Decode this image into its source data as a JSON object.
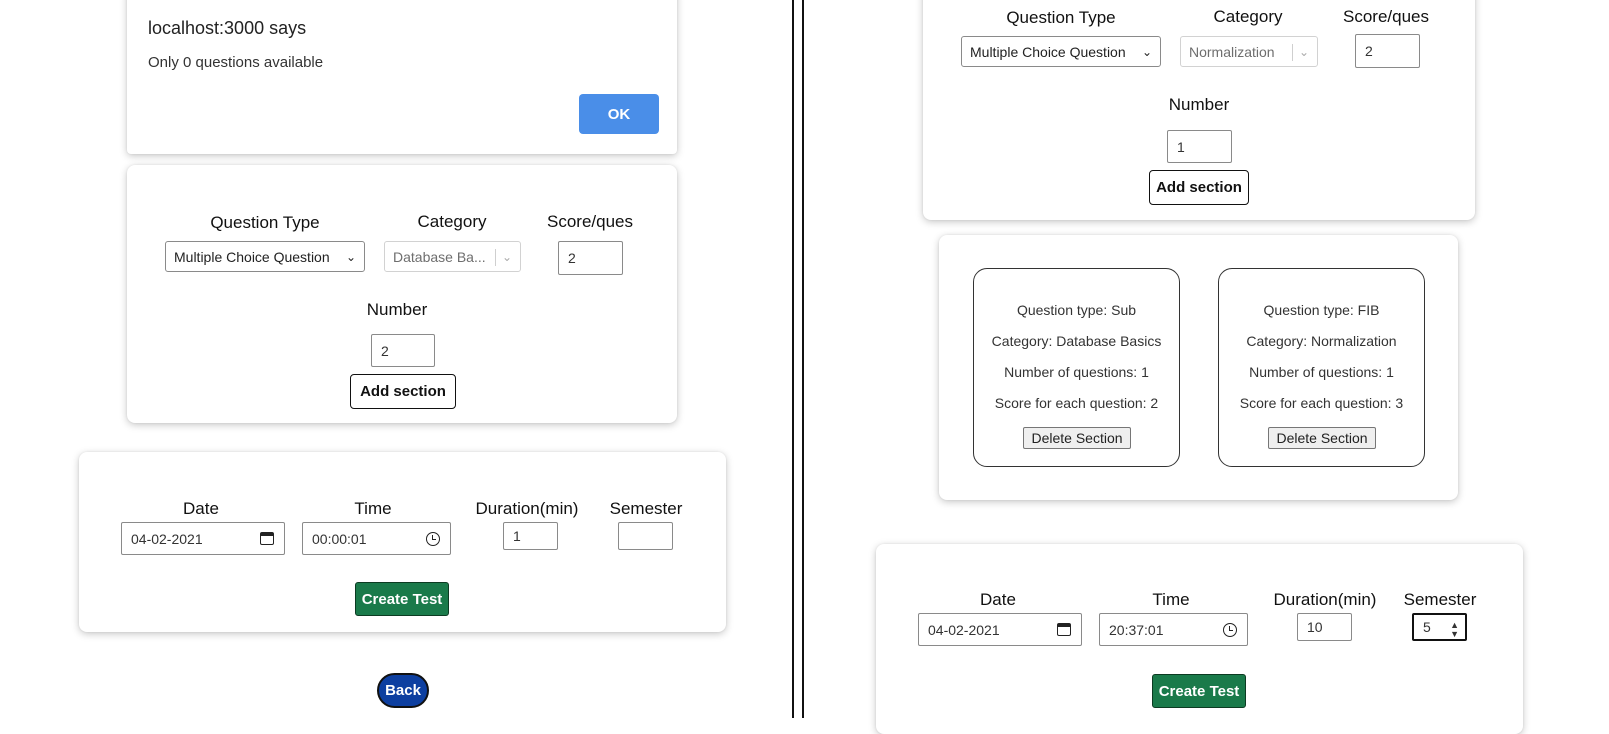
{
  "dialog": {
    "title": "localhost:3000 says",
    "message": "Only 0 questions available",
    "ok_label": "OK"
  },
  "left": {
    "section_form": {
      "question_type_label": "Question Type",
      "question_type_value": "Multiple Choice Question",
      "category_label": "Category",
      "category_value": "Database Ba...",
      "score_label": "Score/ques",
      "score_value": "2",
      "number_label": "Number",
      "number_value": "2",
      "add_section_label": "Add section"
    },
    "test_form": {
      "date_label": "Date",
      "date_value": "04-02-2021",
      "time_label": "Time",
      "time_value": "00:00:01",
      "duration_label": "Duration(min)",
      "duration_value": "1",
      "semester_label": "Semester",
      "semester_value": "",
      "create_label": "Create Test"
    },
    "back_label": "Back"
  },
  "right": {
    "section_form": {
      "question_type_label": "Question Type",
      "question_type_value": "Multiple Choice Question",
      "category_label": "Category",
      "category_value": "Normalization",
      "score_label": "Score/ques",
      "score_value": "2",
      "number_label": "Number",
      "number_value": "1",
      "add_section_label": "Add section"
    },
    "sections": [
      {
        "type": "Question type: Sub",
        "category": "Category: Database Basics",
        "count": "Number of questions: 1",
        "score": "Score for each question: 2",
        "delete_label": "Delete Section"
      },
      {
        "type": "Question type: FIB",
        "category": "Category: Normalization",
        "count": "Number of questions: 1",
        "score": "Score for each question: 3",
        "delete_label": "Delete Section"
      }
    ],
    "test_form": {
      "date_label": "Date",
      "date_value": "04-02-2021",
      "time_label": "Time",
      "time_value": "20:37:01",
      "duration_label": "Duration(min)",
      "duration_value": "10",
      "semester_label": "Semester",
      "semester_value": "5",
      "create_label": "Create Test"
    }
  },
  "colors": {
    "ok_blue": "#4a8ee8",
    "create_green": "#1a7a4a",
    "back_navy": "#0d3fa0"
  }
}
